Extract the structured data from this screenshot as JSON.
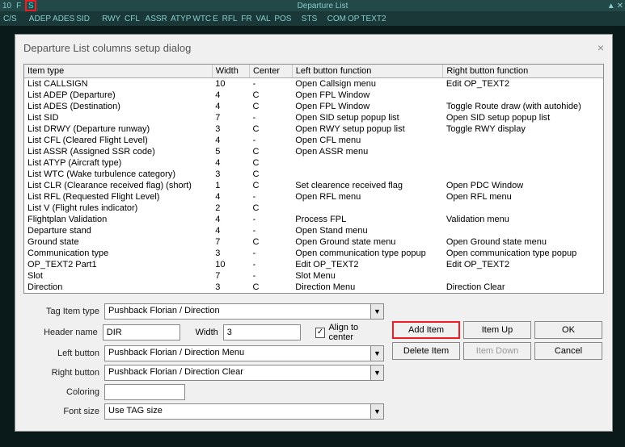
{
  "topbar": {
    "left_num": "10",
    "r_letter": "F",
    "s_letter": "S",
    "title": "Departure List",
    "minimize": "▲",
    "close": "✕",
    "row2": [
      "C/S",
      "    ",
      "ADEP",
      "ADES",
      "SID",
      "    ",
      "RWY",
      " CFL ",
      " ASSR",
      " ATYP",
      "WTC",
      "E",
      " RFL",
      " FR",
      " VAL",
      " POS",
      "   ",
      "STS",
      "   ",
      "COM",
      "OP",
      "TEXT2"
    ]
  },
  "dialog": {
    "title": "Departure List columns setup dialog",
    "close": "×"
  },
  "headers": {
    "item": "Item type",
    "width": "Width",
    "center": "Center",
    "left": "Left button function",
    "right": "Right button function"
  },
  "rows": [
    {
      "item": "List CALLSIGN",
      "w": "10",
      "c": "-",
      "l": "Open Callsign menu",
      "r": "Edit OP_TEXT2"
    },
    {
      "item": "List ADEP (Departure)",
      "w": "4",
      "c": "C",
      "l": "Open FPL Window",
      "r": ""
    },
    {
      "item": "List ADES (Destination)",
      "w": "4",
      "c": "C",
      "l": "Open FPL Window",
      "r": "Toggle Route draw (with autohide)"
    },
    {
      "item": "List SID",
      "w": "7",
      "c": "-",
      "l": "Open SID setup popup list",
      "r": "Open SID setup popup list"
    },
    {
      "item": "List DRWY (Departure runway)",
      "w": "3",
      "c": "C",
      "l": "Open RWY setup popup list",
      "r": "Toggle RWY display"
    },
    {
      "item": "List CFL (Cleared Flight Level)",
      "w": "4",
      "c": "-",
      "l": "Open CFL menu",
      "r": ""
    },
    {
      "item": "List ASSR (Assigned SSR code)",
      "w": "5",
      "c": "C",
      "l": "Open ASSR menu",
      "r": ""
    },
    {
      "item": "List ATYP (Aircraft type)",
      "w": "4",
      "c": "C",
      "l": "",
      "r": ""
    },
    {
      "item": "List WTC (Wake turbulence category)",
      "w": "3",
      "c": "C",
      "l": "",
      "r": ""
    },
    {
      "item": "List CLR (Clearance received flag) (short)",
      "w": "1",
      "c": "C",
      "l": "Set clearence received flag",
      "r": "Open PDC Window"
    },
    {
      "item": "List RFL (Requested Flight Level)",
      "w": "4",
      "c": "-",
      "l": "Open RFL menu",
      "r": "Open RFL menu"
    },
    {
      "item": "List V (Flight rules indicator)",
      "w": "2",
      "c": "C",
      "l": "",
      "r": ""
    },
    {
      "item": "Flightplan Validation",
      "w": "4",
      "c": "-",
      "l": "Process FPL",
      "r": "Validation menu"
    },
    {
      "item": "Departure stand",
      "w": "4",
      "c": "-",
      "l": "Open Stand menu",
      "r": ""
    },
    {
      "item": "Ground state",
      "w": "7",
      "c": "C",
      "l": "Open Ground state menu",
      "r": "Open Ground state menu"
    },
    {
      "item": "Communication type",
      "w": "3",
      "c": "-",
      "l": "Open communication type popup",
      "r": "Open communication type popup"
    },
    {
      "item": "OP_TEXT2 Part1",
      "w": "10",
      "c": "-",
      "l": "Edit OP_TEXT2",
      "r": "Edit OP_TEXT2"
    },
    {
      "item": "Slot",
      "w": "7",
      "c": "-",
      "l": "Slot Menu",
      "r": ""
    },
    {
      "item": "Direction",
      "w": "3",
      "c": "C",
      "l": "Direction Menu",
      "r": "Direction Clear"
    }
  ],
  "form": {
    "tag_item_label": "Tag Item type",
    "tag_item_value": "Pushback Florian / Direction",
    "header_label": "Header name",
    "header_value": "DIR",
    "width_label": "Width",
    "width_value": "3",
    "align_label": "Align to center",
    "align_checked": "✓",
    "left_btn_label": "Left button",
    "left_btn_value": "Pushback Florian / Direction Menu",
    "right_btn_label": "Right button",
    "right_btn_value": "Pushback Florian / Direction Clear",
    "coloring_label": "Coloring",
    "font_label": "Font size",
    "font_value": "Use TAG size"
  },
  "buttons": {
    "add": "Add Item",
    "up": "Item Up",
    "ok": "OK",
    "del": "Delete Item",
    "down": "Item Down",
    "cancel": "Cancel"
  }
}
